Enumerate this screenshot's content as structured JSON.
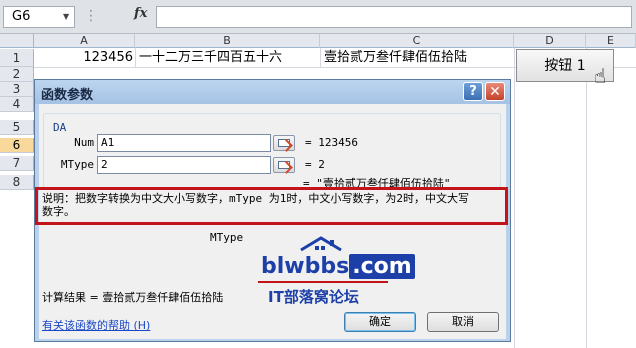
{
  "formula_bar": {
    "name_box": "G6",
    "fx_label": "fx",
    "formula": ""
  },
  "sheet": {
    "columns": [
      "A",
      "B",
      "C",
      "D",
      "E"
    ],
    "rows": [
      "1",
      "2",
      "3",
      "4",
      "5",
      "6",
      "7",
      "8"
    ],
    "selected_row": "6",
    "cells": {
      "A1": "123456",
      "B1": "一十二万三千四百五十六",
      "C1": "壹拾贰万叁仟肆佰伍拾陆"
    },
    "button_label": "按钮 1"
  },
  "dialog": {
    "title": "函数参数",
    "help_glyph": "?",
    "close_glyph": "✕",
    "function_name": "DA",
    "args": [
      {
        "label": "Num",
        "value": "A1",
        "result": "= 123456"
      },
      {
        "label": "MType",
        "value": "2",
        "result": "= 2"
      }
    ],
    "formula_result": "= \"壹拾贰万叁仟肆佰伍拾陆\"",
    "description_line1": "说明：把数字转换为中文大小写数字，mType 为1时，中文小写数字，为2时，中文大写",
    "description_line2": "数字。",
    "arg_help_label": "MType",
    "calc_result": "计算结果 = 壹拾贰万叁仟肆佰伍拾陆",
    "help_link": "有关该函数的帮助 (H)",
    "ok_label": "确定",
    "cancel_label": "取消"
  },
  "watermark": {
    "site": "blwbbs",
    "domain": ".com",
    "subtitle": "IT部落窝论坛"
  },
  "colors": {
    "highlight": "#c4141b",
    "watermark": "#1d3fa8",
    "selected_row": "#f9d99b"
  }
}
